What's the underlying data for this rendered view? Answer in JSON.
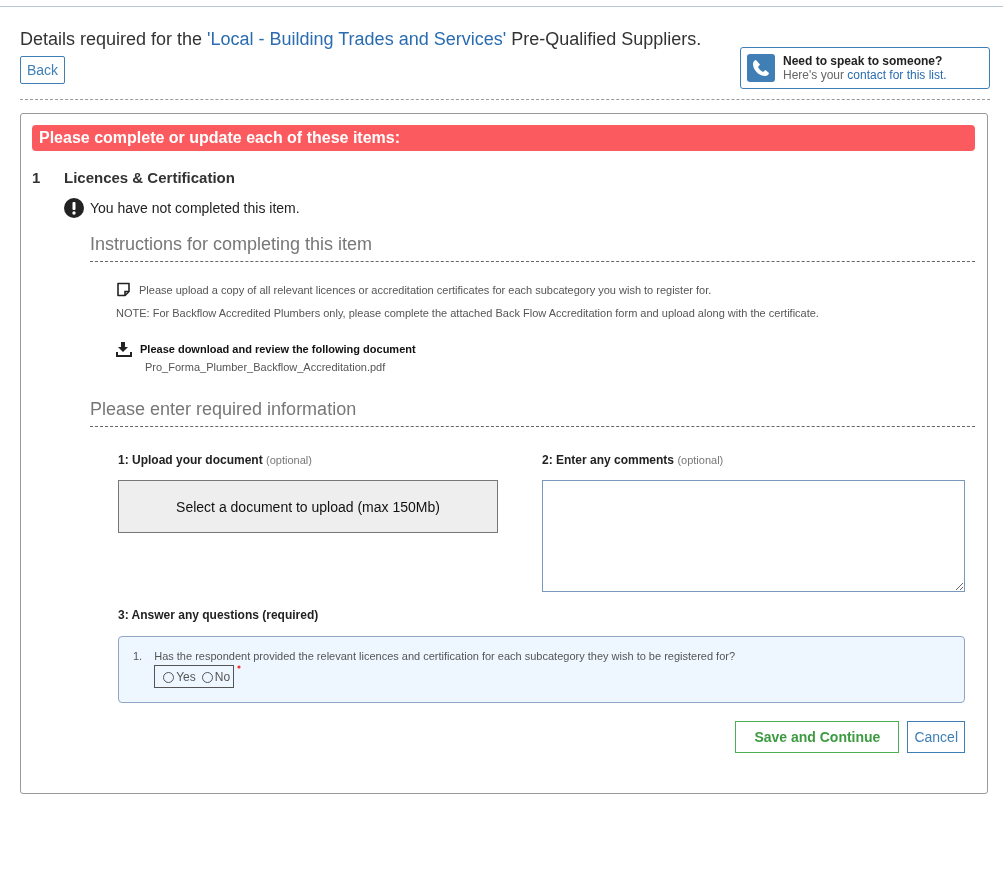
{
  "header": {
    "title_before": "Details required for the ",
    "title_link": "'Local - Building Trades and Services'",
    "title_after": " Pre-Qualified Suppliers.",
    "back_button": "Back"
  },
  "contact": {
    "heading": "Need to speak to someone?",
    "text_before": "Here's your ",
    "link": "contact for this list."
  },
  "banner": "Please complete or update each of these items:",
  "item": {
    "number": "1",
    "title": "Licences & Certification",
    "status": "You have not completed this item.",
    "instructions_heading": "Instructions for completing this item",
    "instruction": "Please upload a copy of all relevant licences or accreditation certificates for each subcategory you wish to register for.",
    "note": "NOTE: For Backflow Accredited Plumbers only, please complete the attached Back Flow Accreditation form and upload along with the certificate.",
    "download_heading": "Please download and review the following document",
    "download_link": "Pro_Forma_Plumber_Backflow_Accreditation.pdf",
    "info_heading": "Please enter required information",
    "upload": {
      "label": "1: Upload your document",
      "hint": "(optional)",
      "button": "Select a document to upload (max 150Mb)"
    },
    "comments": {
      "label": "2: Enter any comments",
      "hint": "(optional)"
    },
    "questions": {
      "label": "3: Answer any questions (required)",
      "items": [
        {
          "number": "1.",
          "text": "Has the respondent provided the relevant licences and certification for each subcategory they wish to be registered for?",
          "required": true,
          "options": [
            {
              "label": "Yes",
              "selected": false
            },
            {
              "label": "No",
              "selected": false
            }
          ]
        }
      ]
    }
  },
  "buttons": {
    "save": "Save and Continue",
    "cancel": "Cancel"
  }
}
